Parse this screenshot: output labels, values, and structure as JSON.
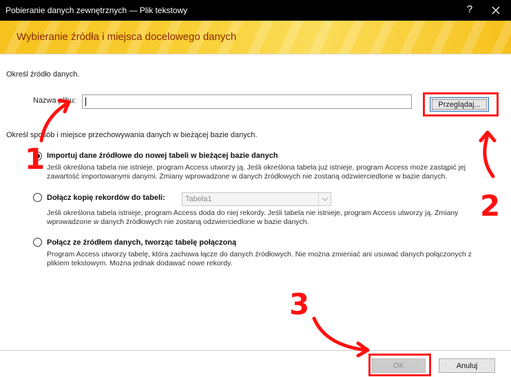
{
  "window": {
    "title": "Pobieranie danych zewnętrznych — Plik tekstowy",
    "help_glyph": "?",
    "banner_title": "Wybieranie źródła i miejsca docelowego danych"
  },
  "source": {
    "section_label": "Określ źródło danych.",
    "file_label": "Nazwa pliku:",
    "file_value": "",
    "browse_label": "Przeglądaj..."
  },
  "storage": {
    "section_label": "Określ sposób i miejsce przechowywania danych w bieżącej bazie danych.",
    "options": [
      {
        "label": "Importuj dane źródłowe do nowej tabeli w bieżącej bazie danych",
        "checked": true,
        "desc_line1": "Jeśli określona tabela nie istnieje, program Access utworzy ją. Jeśli określona tabela już istnieje, program Access może zastąpić jej",
        "desc_line2": "zawartość importowanymi danymi. Zmiany wprowadzone w danych źródłowych nie zostaną odzwierciedlone w bazie danych."
      },
      {
        "label": "Dołącz kopię rekordów do tabeli:",
        "checked": false,
        "table_value": "Tabela1",
        "desc_line1": "Jeśli określona tabela istnieje, program Access doda do niej rekordy. Jeśli tabela nie istnieje, program Access utworzy ją. Zmiany",
        "desc_line2": "wprowadzone w danych źródłowych nie zostaną odzwierciedlone w bazie danych."
      },
      {
        "label": "Połącz ze źródłem danych, tworząc tabelę połączoną",
        "checked": false,
        "desc_line1": "Program Access utworzy tabelę, która zachowa łącze do danych źródłowych. Nie można zmieniać ani usuwać danych połączonych z",
        "desc_line2": "plikiem tekstowym. Można jednak dodawać nowe rekordy."
      }
    ]
  },
  "buttons": {
    "ok": "OK",
    "cancel": "Anuluj"
  },
  "annotations": {
    "n1": "1",
    "n2": "2",
    "n3": "3",
    "color": "#ff1010"
  },
  "colors": {
    "banner": "#f9ce32",
    "banner_text": "#8b2a00",
    "titlebar": "#000000"
  }
}
